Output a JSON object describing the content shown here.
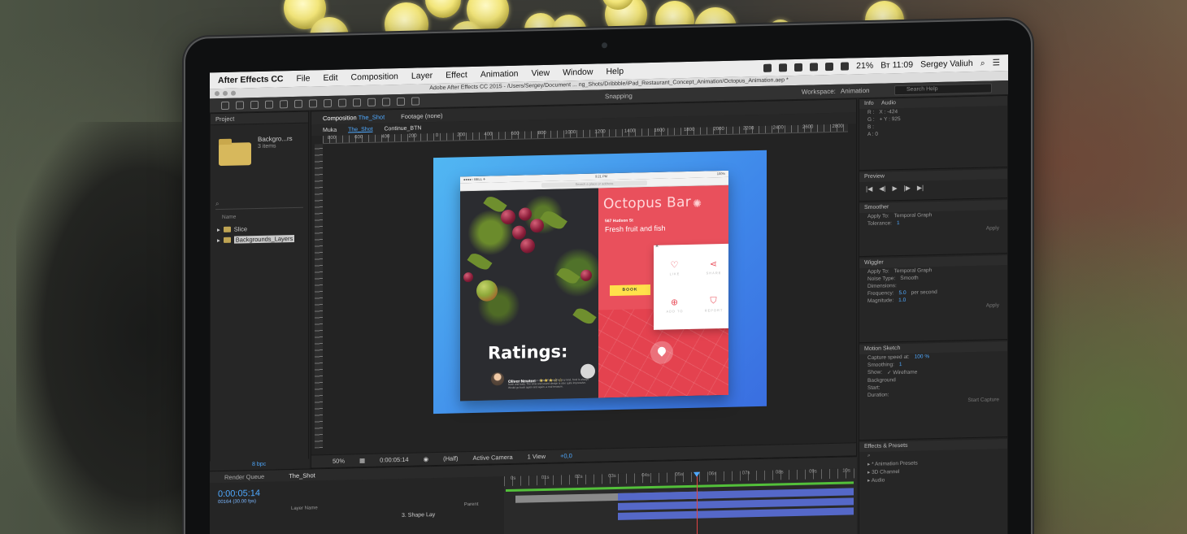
{
  "menubar": {
    "app": "After Effects CC",
    "items": [
      "File",
      "Edit",
      "Composition",
      "Layer",
      "Effect",
      "Animation",
      "View",
      "Window",
      "Help"
    ],
    "battery": "21%",
    "time": "Вт 11:09",
    "user": "Sergey Valiuh"
  },
  "window": {
    "title": "Adobe After Effects CC 2015 - /Users/Sergey/Document ... ng_Shots/Dribbble/iPad_Restaurant_Concept_Animation/Octopus_Animation.aep *"
  },
  "toolbar": {
    "snapping": "Snapping",
    "workspace_label": "Workspace:",
    "workspace_value": "Animation",
    "search_placeholder": "Search Help"
  },
  "project": {
    "header": "Project",
    "item_name": "Backgro...rs",
    "item_count": "3 items",
    "search_icon": "search-icon",
    "name_col": "Name",
    "rows": [
      "Slice",
      "Backgrounds_Layers"
    ]
  },
  "composition": {
    "tab_label": "Composition",
    "tab_comp": "The_Shot",
    "footage_tab": "Footage (none)",
    "crumbs": [
      "Muka",
      "The_Shot",
      "Continue_BTN"
    ],
    "ruler": [
      "800",
      "600",
      "400",
      "200",
      "0",
      "200",
      "400",
      "600",
      "800",
      "1000",
      "1200",
      "1400",
      "1600",
      "1800",
      "2000",
      "2200",
      "2400",
      "2600",
      "2800"
    ],
    "zoom": "50%",
    "timecode": "0:00:05:14",
    "resolution": "(Half)",
    "camera": "Active Camera",
    "views": "1 View",
    "offset": "+0,0"
  },
  "artwork": {
    "status_left": "●●●●○ BELL ✈",
    "status_time": "9:21 PM",
    "status_right": "100%",
    "search_placeholder": "Search a place or address",
    "ratings_title": "Ratings:",
    "reviewer_name": "Oliver Newton",
    "reviewer_stars": "★★★☆☆",
    "reviewer_text": "It's a lovely place to go for dinner. The staff is very kind, food is always fresh and tasty. The view and sound design is also quite impressive. Would go back again and again, a real treasure.",
    "pager": "● ● ●",
    "restaurant_name": "Octopus Bar",
    "restaurant_icon": "octopus-icon",
    "address": "567 Hudson St",
    "tagline": "Fresh fruit and fish",
    "book_label": "BOOK",
    "actions": [
      {
        "icon": "heart-icon",
        "glyph": "♡",
        "label": "LIKE"
      },
      {
        "icon": "share-icon",
        "glyph": "⋖",
        "label": "SHARE"
      },
      {
        "icon": "add-icon",
        "glyph": "⊕",
        "label": "ADD TO"
      },
      {
        "icon": "shield-icon",
        "glyph": "⛉",
        "label": "REPORT"
      }
    ],
    "close_glyph": "×"
  },
  "info_panel": {
    "tabs": [
      "Info",
      "Audio"
    ],
    "lines": [
      [
        "R :",
        "X : -424"
      ],
      [
        "G :",
        "+ Y : 925"
      ],
      [
        "B :",
        ""
      ],
      [
        "A : 0",
        ""
      ]
    ]
  },
  "preview_panel": {
    "header": "Preview",
    "controls": [
      "|◀",
      "◀|",
      "▶",
      "|▶",
      "▶|"
    ]
  },
  "smoother_panel": {
    "header": "Smoother",
    "apply_label": "Apply To:",
    "apply_value": "Temporal Graph",
    "tolerance_label": "Tolerance:",
    "tolerance_value": "1",
    "apply_button": "Apply"
  },
  "wiggler_panel": {
    "header": "Wiggler",
    "apply_label": "Apply To:",
    "apply_value": "Temporal Graph",
    "noise_label": "Noise Type:",
    "noise_value": "Smooth",
    "dimensions_label": "Dimensions:",
    "frequency_label": "Frequency:",
    "frequency_value": "5.0",
    "frequency_unit": "per second",
    "magnitude_label": "Magnitude:",
    "magnitude_value": "1.0",
    "apply_button": "Apply"
  },
  "motion_sketch_panel": {
    "header": "Motion Sketch",
    "speed_label": "Capture speed at:",
    "speed_value": "100 %",
    "smoothing_label": "Smoothing:",
    "smoothing_value": "1",
    "show_label": "Show:",
    "wireframe": "✓ Wireframe",
    "background": "Background",
    "start_label": "Start:",
    "duration_label": "Duration:",
    "capture_button": "Start Capture"
  },
  "effects_panel": {
    "header": "Effects & Presets",
    "items": [
      "▸ * Animation Presets",
      "▸ 3D Channel",
      "▸ Audio"
    ]
  },
  "timeline": {
    "render_queue": "Render Queue",
    "comp_tab": "The_Shot",
    "timecode": "0:00:05:14",
    "fps": "00164 (30.00 fps)",
    "bpc": "8 bpc",
    "layer_col": "Layer Name",
    "parent_col": "Parent",
    "parent_value": "3. Shape Lay",
    "ruler": [
      "0s",
      "01s",
      "02s",
      "03s",
      "04s",
      "05s",
      "06s",
      "07s",
      "08s",
      "09s",
      "10s"
    ],
    "playhead_seconds": 5.47,
    "duration_seconds": 10
  }
}
